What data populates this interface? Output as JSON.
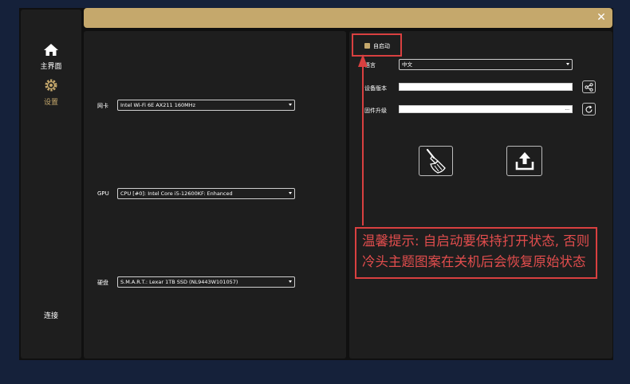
{
  "window": {
    "close_glyph": "✕",
    "accent_color": "#c5a86c",
    "annotation_color": "#d94040"
  },
  "sidebar": {
    "items": [
      {
        "label": "主界面",
        "icon": "home-icon",
        "active": false
      },
      {
        "label": "设置",
        "icon": "gear-icon",
        "active": true
      },
      {
        "label": "连接",
        "icon": null,
        "active": false
      }
    ]
  },
  "hardware": {
    "nic": {
      "label": "网卡",
      "value": "Intel Wi-Fi 6E AX211 160MHz"
    },
    "gpu": {
      "label": "GPU",
      "value": "CPU [#0]: Intel Core i5-12600KF: Enhanced"
    },
    "disk": {
      "label": "硬盘",
      "value": "S.M.A.R.T.: Lexar 1TB SSD (NL9443W101057)"
    }
  },
  "settings": {
    "autostart": {
      "label": "自启动",
      "checked": true
    },
    "language": {
      "label": "语言",
      "value": "中文"
    },
    "device_version": {
      "label": "设备版本",
      "value": ""
    },
    "firmware_upgrade": {
      "label": "固件升级",
      "value": "..."
    }
  },
  "actions": {
    "share_icon": "share-icon",
    "refresh_icon": "refresh-icon",
    "clean_icon": "broom-icon",
    "upload_icon": "upload-icon"
  },
  "warning": {
    "line1": "温馨提示: 自启动要保持打开状态, 否则",
    "line2": "冷头主题图案在关机后会恢复原始状态"
  }
}
